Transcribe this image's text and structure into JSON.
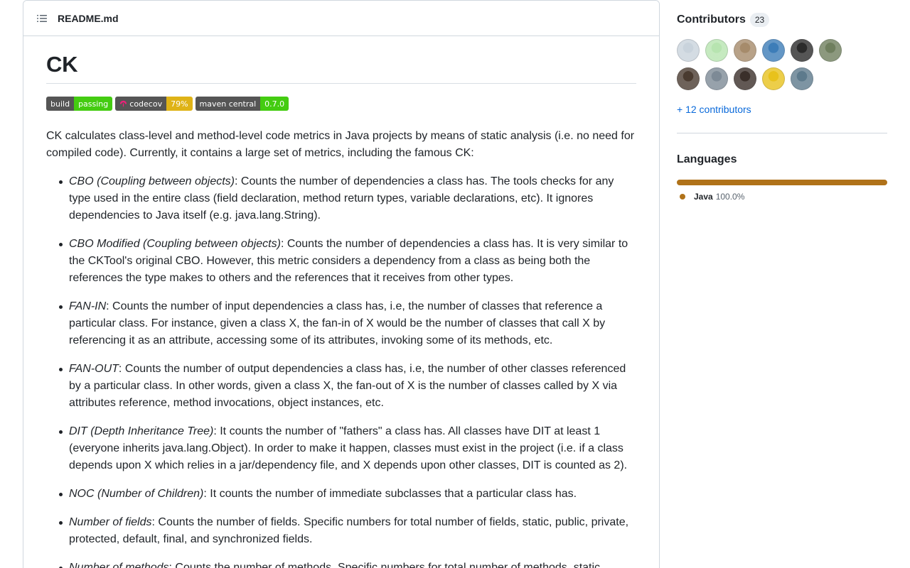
{
  "readme": {
    "filename": "README.md",
    "title": "CK",
    "badges": [
      {
        "left": "build",
        "right": "passing",
        "color": "#4c1"
      },
      {
        "left": "codecov",
        "right": "79%",
        "color": "#dfb317"
      },
      {
        "left": "maven central",
        "right": "0.7.0",
        "color": "#4c1"
      }
    ],
    "intro": "CK calculates class-level and method-level code metrics in Java projects by means of static analysis (i.e. no need for compiled code). Currently, it contains a large set of metrics, including the famous CK:",
    "metrics": [
      {
        "name": "CBO (Coupling between objects)",
        "desc": ": Counts the number of dependencies a class has. The tools checks for any type used in the entire class (field declaration, method return types, variable declarations, etc). It ignores dependencies to Java itself (e.g. java.lang.String)."
      },
      {
        "name": "CBO Modified (Coupling between objects)",
        "desc": ": Counts the number of dependencies a class has. It is very similar to the CKTool's original CBO. However, this metric considers a dependency from a class as being both the references the type makes to others and the references that it receives from other types."
      },
      {
        "name": "FAN-IN",
        "desc": ": Counts the number of input dependencies a class has, i.e, the number of classes that reference a particular class. For instance, given a class X, the fan-in of X would be the number of classes that call X by referencing it as an attribute, accessing some of its attributes, invoking some of its methods, etc."
      },
      {
        "name": "FAN-OUT",
        "desc": ": Counts the number of output dependencies a class has, i.e, the number of other classes referenced by a particular class. In other words, given a class X, the fan-out of X is the number of classes called by X via attributes reference, method invocations, object instances, etc."
      },
      {
        "name": "DIT (Depth Inheritance Tree)",
        "desc": ": It counts the number of \"fathers\" a class has. All classes have DIT at least 1 (everyone inherits java.lang.Object). In order to make it happen, classes must exist in the project (i.e. if a class depends upon X which relies in a jar/dependency file, and X depends upon other classes, DIT is counted as 2)."
      },
      {
        "name": "NOC (Number of Children)",
        "desc": ": It counts the number of immediate subclasses that a particular class has."
      },
      {
        "name": "Number of fields",
        "desc": ": Counts the number of fields. Specific numbers for total number of fields, static, public, private, protected, default, final, and synchronized fields."
      },
      {
        "name": "Number of methods",
        "desc": ": Counts the number of methods. Specific numbers for total number of methods, static, public, abstract, private, protected, default, final, and synchronized methods."
      }
    ]
  },
  "sidebar": {
    "contributors_title": "Contributors",
    "contributors_count": "23",
    "more_contributors": "+ 12 contributors",
    "avatar_colors": [
      "#c9d3dc",
      "#b7e4b0",
      "#a68b6b",
      "#3d7db8",
      "#2b2b2b",
      "#6f7f5e",
      "#4a3b30",
      "#7d8a96",
      "#3a2f2a",
      "#e8c21c",
      "#5d7a8c"
    ],
    "languages_title": "Languages",
    "languages": [
      {
        "name": "Java",
        "percent": "100.0%",
        "color": "#b07219"
      }
    ]
  }
}
